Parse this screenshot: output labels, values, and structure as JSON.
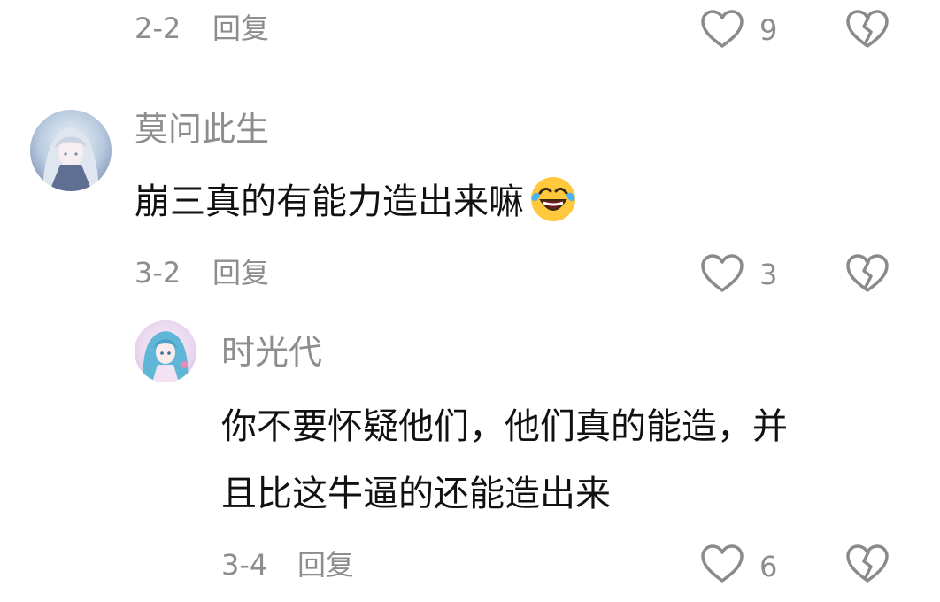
{
  "comments": [
    {
      "meta": {
        "date": "2-2",
        "reply_label": "回复",
        "likes": "9"
      }
    },
    {
      "username": "莫问此生",
      "text": "崩三真的有能力造出来嘛",
      "emoji": "laughing-crying-emoji",
      "meta": {
        "date": "3-2",
        "reply_label": "回复",
        "likes": "3"
      }
    },
    {
      "username": "时光代",
      "text_lines": [
        "你不要怀疑他们，他们真的能造，并",
        "且比这牛逼的还能造出来"
      ],
      "meta": {
        "date": "3-4",
        "reply_label": "回复",
        "likes": "6"
      }
    }
  ],
  "icons": {
    "like": "heart-outline-icon",
    "dislike": "broken-heart-icon"
  },
  "colors": {
    "meta_gray": "#8d8d8d",
    "text_dark": "#111111",
    "icon_gray": "#8a8a8a"
  }
}
